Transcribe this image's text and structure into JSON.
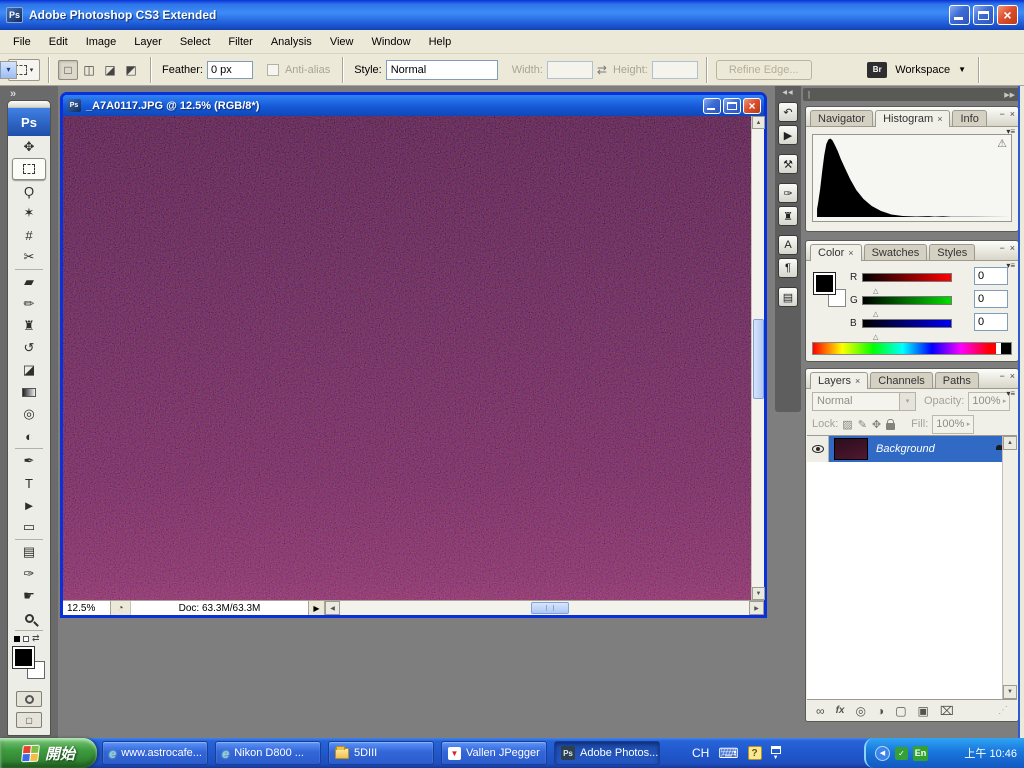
{
  "app": {
    "title": "Adobe Photoshop CS3 Extended",
    "logo": "Ps"
  },
  "menu": [
    "File",
    "Edit",
    "Image",
    "Layer",
    "Select",
    "Filter",
    "Analysis",
    "View",
    "Window",
    "Help"
  ],
  "options": {
    "feather_label": "Feather:",
    "feather_value": "0 px",
    "antialias_label": "Anti-alias",
    "style_label": "Style:",
    "style_value": "Normal",
    "width_label": "Width:",
    "height_label": "Height:",
    "refine_edge_label": "Refine Edge...",
    "bridge_label": "Br",
    "workspace_label": "Workspace"
  },
  "toolbox": {
    "logo": "Ps",
    "collapse": "»",
    "tools": [
      {
        "name": "move",
        "glyph": "✥"
      },
      {
        "name": "rectangular-marquee",
        "glyph": ""
      },
      {
        "name": "lasso",
        "glyph": "Ϙ"
      },
      {
        "name": "quick-selection",
        "glyph": "✶"
      },
      {
        "name": "crop",
        "glyph": "#"
      },
      {
        "name": "slice",
        "glyph": "✂"
      },
      {
        "name": "spot-healing-brush",
        "glyph": "▰"
      },
      {
        "name": "brush",
        "glyph": "✏"
      },
      {
        "name": "clone-stamp",
        "glyph": "♜"
      },
      {
        "name": "history-brush",
        "glyph": "↺"
      },
      {
        "name": "eraser",
        "glyph": "◪"
      },
      {
        "name": "gradient",
        "glyph": ""
      },
      {
        "name": "blur",
        "glyph": "◎"
      },
      {
        "name": "dodge",
        "glyph": "◐"
      },
      {
        "name": "pen",
        "glyph": "✒"
      },
      {
        "name": "type",
        "glyph": "T"
      },
      {
        "name": "path-selection",
        "glyph": "►"
      },
      {
        "name": "rectangle",
        "glyph": "▭"
      },
      {
        "name": "notes",
        "glyph": "▤"
      },
      {
        "name": "eyedropper",
        "glyph": "✑"
      },
      {
        "name": "hand",
        "glyph": "☛"
      },
      {
        "name": "zoom",
        "glyph": ""
      }
    ]
  },
  "icon_dock": {
    "collapse": "◀◀",
    "icons": [
      {
        "name": "history",
        "glyph": "↶"
      },
      {
        "name": "actions",
        "glyph": "▶"
      },
      {
        "name": "tool-presets",
        "glyph": "⚒"
      },
      {
        "name": "brushes",
        "glyph": "✑"
      },
      {
        "name": "clone-source",
        "glyph": "♜"
      },
      {
        "name": "character",
        "glyph": "A"
      },
      {
        "name": "paragraph",
        "glyph": "¶"
      },
      {
        "name": "layer-comps",
        "glyph": "▤"
      }
    ]
  },
  "document": {
    "title": "_A7A0117.JPG @ 12.5% (RGB/8*)",
    "zoom_level": "12.5%",
    "doc_info": "Doc: 63.3M/63.3M"
  },
  "panel_dock": {
    "collapse": "▶▶"
  },
  "panels": {
    "histogram": {
      "tabs": [
        "Navigator",
        "Histogram",
        "Info"
      ],
      "warning": "⚠"
    },
    "color": {
      "tabs": [
        "Color",
        "Swatches",
        "Styles"
      ],
      "channels": [
        {
          "label": "R",
          "value": "0"
        },
        {
          "label": "G",
          "value": "0"
        },
        {
          "label": "B",
          "value": "0"
        }
      ]
    },
    "layers": {
      "tabs": [
        "Layers",
        "Channels",
        "Paths"
      ],
      "blend_mode": "Normal",
      "opacity_label": "Opacity:",
      "opacity_value": "100%",
      "lock_label": "Lock:",
      "fill_label": "Fill:",
      "fill_value": "100%",
      "layer_name": "Background",
      "buttons": [
        {
          "name": "link-layers",
          "glyph": "∞"
        },
        {
          "name": "layer-style",
          "glyph": "fx"
        },
        {
          "name": "add-layer-mask",
          "glyph": "◎"
        },
        {
          "name": "new-adjustment-layer",
          "glyph": "◑"
        },
        {
          "name": "new-group",
          "glyph": "▢"
        },
        {
          "name": "new-layer",
          "glyph": "▣"
        },
        {
          "name": "delete-layer",
          "glyph": "⌧"
        }
      ]
    }
  },
  "ui": {
    "tab_close": "×",
    "panel_minimize": "−",
    "panel_close": "×",
    "panel_menu": "▾≡",
    "scroll_up": "▲",
    "scroll_down": "▼",
    "scroll_left": "◀",
    "scroll_right": "▶",
    "status_expand": "▶",
    "swap_arrow": "⇄",
    "dropdown_arrow": "▾",
    "spinner_arrow": "▸",
    "mode_buttons": [
      "□",
      "◫",
      "◪",
      "◩"
    ],
    "lock_icons": [
      "▨",
      "✎",
      "✥"
    ],
    "status_icon": "◔",
    "grip": "∥",
    "corner_grip": "⋰"
  },
  "taskbar": {
    "start_label": "開始",
    "buttons": [
      {
        "label": "www.astrocafe...",
        "icon": "ie"
      },
      {
        "label": "Nikon D800 ...",
        "icon": "ie"
      },
      {
        "label": "5DIII",
        "icon": "folder"
      },
      {
        "label": "Vallen JPegger",
        "icon": "vallen"
      },
      {
        "label": "Adobe Photos...",
        "icon": "ps"
      }
    ],
    "language": "CH",
    "help": "?",
    "ie_glyph": "e",
    "vallen_glyph": "▼",
    "ps_glyph": "Ps",
    "keyboard_glyph": "⌨",
    "tray_hide_glyph": "◀",
    "tray_green_glyph": "✓",
    "tray_lang_glyph": "En",
    "clock": "上午 10:46"
  }
}
